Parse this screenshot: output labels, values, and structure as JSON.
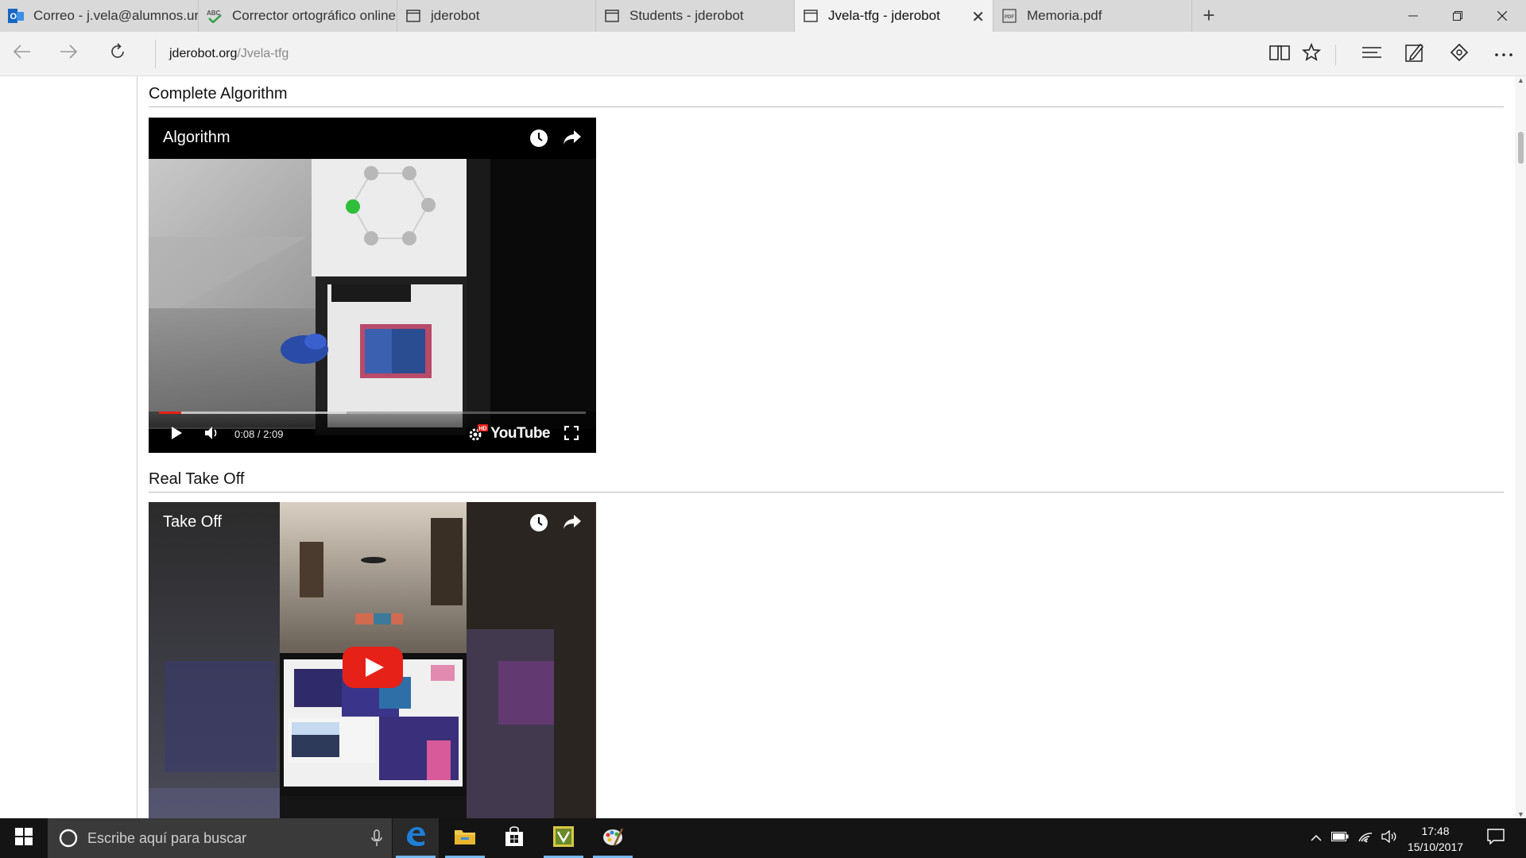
{
  "tabs": [
    {
      "label": "Correo - j.vela@alumnos.urj",
      "active": false
    },
    {
      "label": "Corrector ortográfico online",
      "active": false
    },
    {
      "label": "jderobot",
      "active": false
    },
    {
      "label": "Students - jderobot",
      "active": false
    },
    {
      "label": "Jvela-tfg - jderobot",
      "active": true
    },
    {
      "label": "Memoria.pdf",
      "active": false
    }
  ],
  "address": {
    "domain": "jderobot.org",
    "path": "/Jvela-tfg"
  },
  "sections": [
    {
      "title": "Complete Algorithm",
      "video": {
        "title": "Algorithm",
        "time": "0:08 / 2:09",
        "progress_played": 0.053,
        "progress_buffered": 0.44,
        "logo": "YouTube",
        "hd_badge": "HD"
      }
    },
    {
      "title": "Real Take Off",
      "video": {
        "title": "Take Off"
      }
    }
  ],
  "taskbar": {
    "search_placeholder": "Escribe aquí para buscar",
    "time": "17:48",
    "date": "15/10/2017"
  },
  "colors": {
    "tabbar": "#d9d9d9",
    "active_tab": "#f2f2f2",
    "youtube_red": "#e62117",
    "taskbar": "#141414",
    "edge_blue": "#1e7fd6"
  },
  "icons": [
    "outlook-icon",
    "spellcheck-icon",
    "page-icon",
    "pdf-icon",
    "back-arrow-icon",
    "forward-arrow-icon",
    "refresh-icon",
    "reading-view-icon",
    "favorite-star-icon",
    "hub-icon",
    "web-note-icon",
    "share-icon",
    "more-icon",
    "clock-icon",
    "share-arrow-icon",
    "play-icon",
    "volume-icon",
    "settings-gear-icon",
    "fullscreen-icon",
    "youtube-play-icon",
    "windows-start-icon",
    "cortana-icon",
    "microphone-icon",
    "edge-icon",
    "file-explorer-icon",
    "store-icon",
    "app-icon",
    "paint-icon",
    "chevron-up-icon",
    "battery-icon",
    "wifi-icon",
    "speaker-icon",
    "notification-icon"
  ]
}
